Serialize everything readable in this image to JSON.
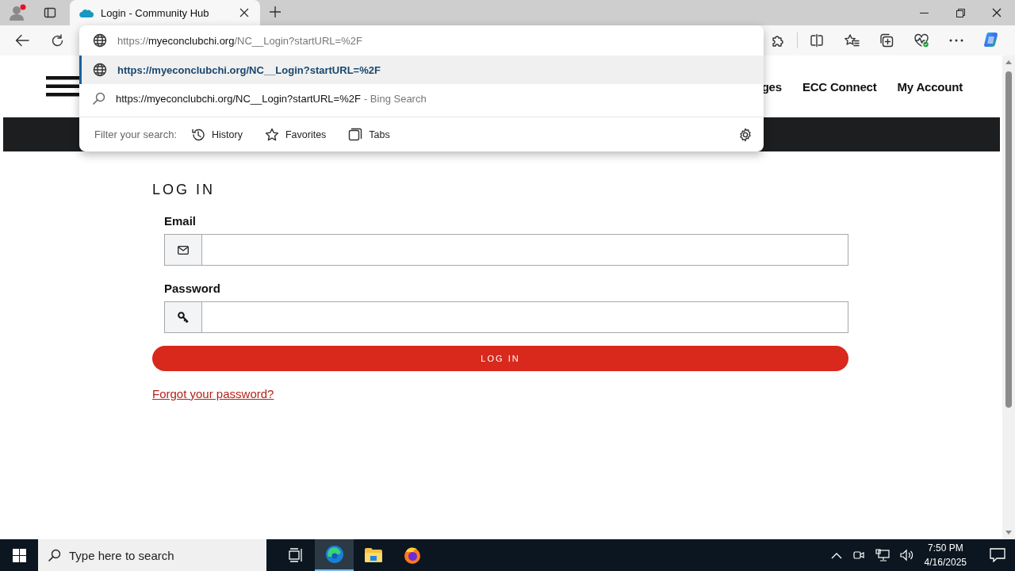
{
  "browser": {
    "tab": {
      "title": "Login - Community Hub",
      "selected": true
    },
    "address_bar": {
      "scheme": "https://",
      "host": "myeconclubchi.org",
      "path": "/NC__Login?startURL=%2F"
    },
    "suggestions": [
      {
        "kind": "url",
        "text": "https://myeconclubchi.org/NC__Login?startURL=%2F",
        "selected": true
      },
      {
        "kind": "search",
        "text": "https://myeconclubchi.org/NC__Login?startURL=%2F",
        "suffix": "- Bing Search",
        "selected": false
      }
    ],
    "filter": {
      "label": "Filter your search:",
      "options": [
        {
          "kind": "history",
          "label": "History"
        },
        {
          "kind": "favorites",
          "label": "Favorites"
        },
        {
          "kind": "tabs",
          "label": "Tabs"
        }
      ]
    }
  },
  "site": {
    "nav": [
      "ges",
      "ECC Connect",
      "My Account"
    ],
    "login": {
      "heading": "LOG IN",
      "fields": [
        {
          "kind": "email",
          "label": "Email"
        },
        {
          "kind": "password",
          "label": "Password"
        }
      ],
      "submit": "LOG IN",
      "forgot_link": "Forgot your password?"
    }
  },
  "taskbar": {
    "search_placeholder": "Type here to search",
    "apps": [
      {
        "kind": "taskview",
        "active": false
      },
      {
        "kind": "edge",
        "active": true
      },
      {
        "kind": "explorer",
        "active": false
      },
      {
        "kind": "firefox",
        "active": false
      }
    ],
    "time": "7:50 PM",
    "date": "4/16/2025"
  }
}
